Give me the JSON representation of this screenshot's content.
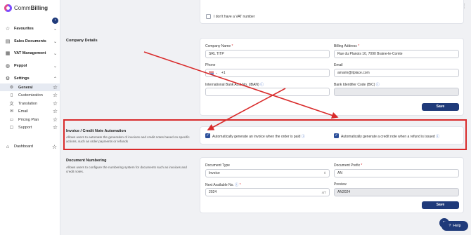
{
  "brand": {
    "name_prefix": "Comm",
    "name_bold": "Billing"
  },
  "sidebar": {
    "collapse_badge": "‹",
    "groups": [
      {
        "label": "Favourites",
        "icon": "star-icon"
      },
      {
        "label": "Sales Documents",
        "icon": "document-icon"
      },
      {
        "label": "VAT Management",
        "icon": "vat-icon"
      },
      {
        "label": "Peppol",
        "icon": "globe-icon"
      },
      {
        "label": "Settings",
        "icon": "gear-icon"
      }
    ],
    "settings_items": [
      {
        "label": "General",
        "icon": "gear-icon",
        "active": true
      },
      {
        "label": "Customization",
        "icon": "page-icon"
      },
      {
        "label": "Translation",
        "icon": "translate-icon"
      },
      {
        "label": "Email",
        "icon": "email-icon"
      },
      {
        "label": "Pricing Plan",
        "icon": "pricing-icon"
      },
      {
        "label": "Support",
        "icon": "support-icon"
      }
    ],
    "dashboard": {
      "label": "Dashboard",
      "icon": "home-icon"
    }
  },
  "vat": {
    "no_vat_label": "I don't have a VAT number"
  },
  "company": {
    "title": "Company Details",
    "name_label": "Company Name",
    "name_value": "SRL TITP",
    "billing_label": "Billing Address",
    "billing_value": "Rue du Planois 10, 7090 Braine-le-Comte",
    "phone_label": "Phone",
    "phone_prefix": "+1",
    "email_label": "Email",
    "email_value": "amarin@itplace.com",
    "iban_label": "International Bank Acct No. (IBAN)",
    "bic_label": "Bank Identifier Code (BIC)",
    "save_label": "Save"
  },
  "automation": {
    "title": "Invoice / Credit Note Automation",
    "description": "Allows users to automate the generation of invoices and credit notes based on specific actions, such as order payments or refunds",
    "invoice_label": "Automatically generate an invoice when the order is paid",
    "credit_label": "Automatically generate a credit note when a refund is issued"
  },
  "numbering": {
    "title": "Document Numbering",
    "description": "Allows users to configure the numbering system for documents such as invoices and credit notes.",
    "type_label": "Document Type",
    "type_value": "Invoice",
    "prefix_label": "Document Prefix",
    "prefix_value": "AN",
    "next_label": "Next Available No.",
    "next_value": "2024",
    "next_counter": "4/7",
    "preview_label": "Preview",
    "preview_value": "AN2024",
    "save_label": "Save"
  },
  "help": {
    "label": "Help"
  },
  "colors": {
    "primary": "#1f3a7a",
    "annotation": "#d92b2b"
  }
}
